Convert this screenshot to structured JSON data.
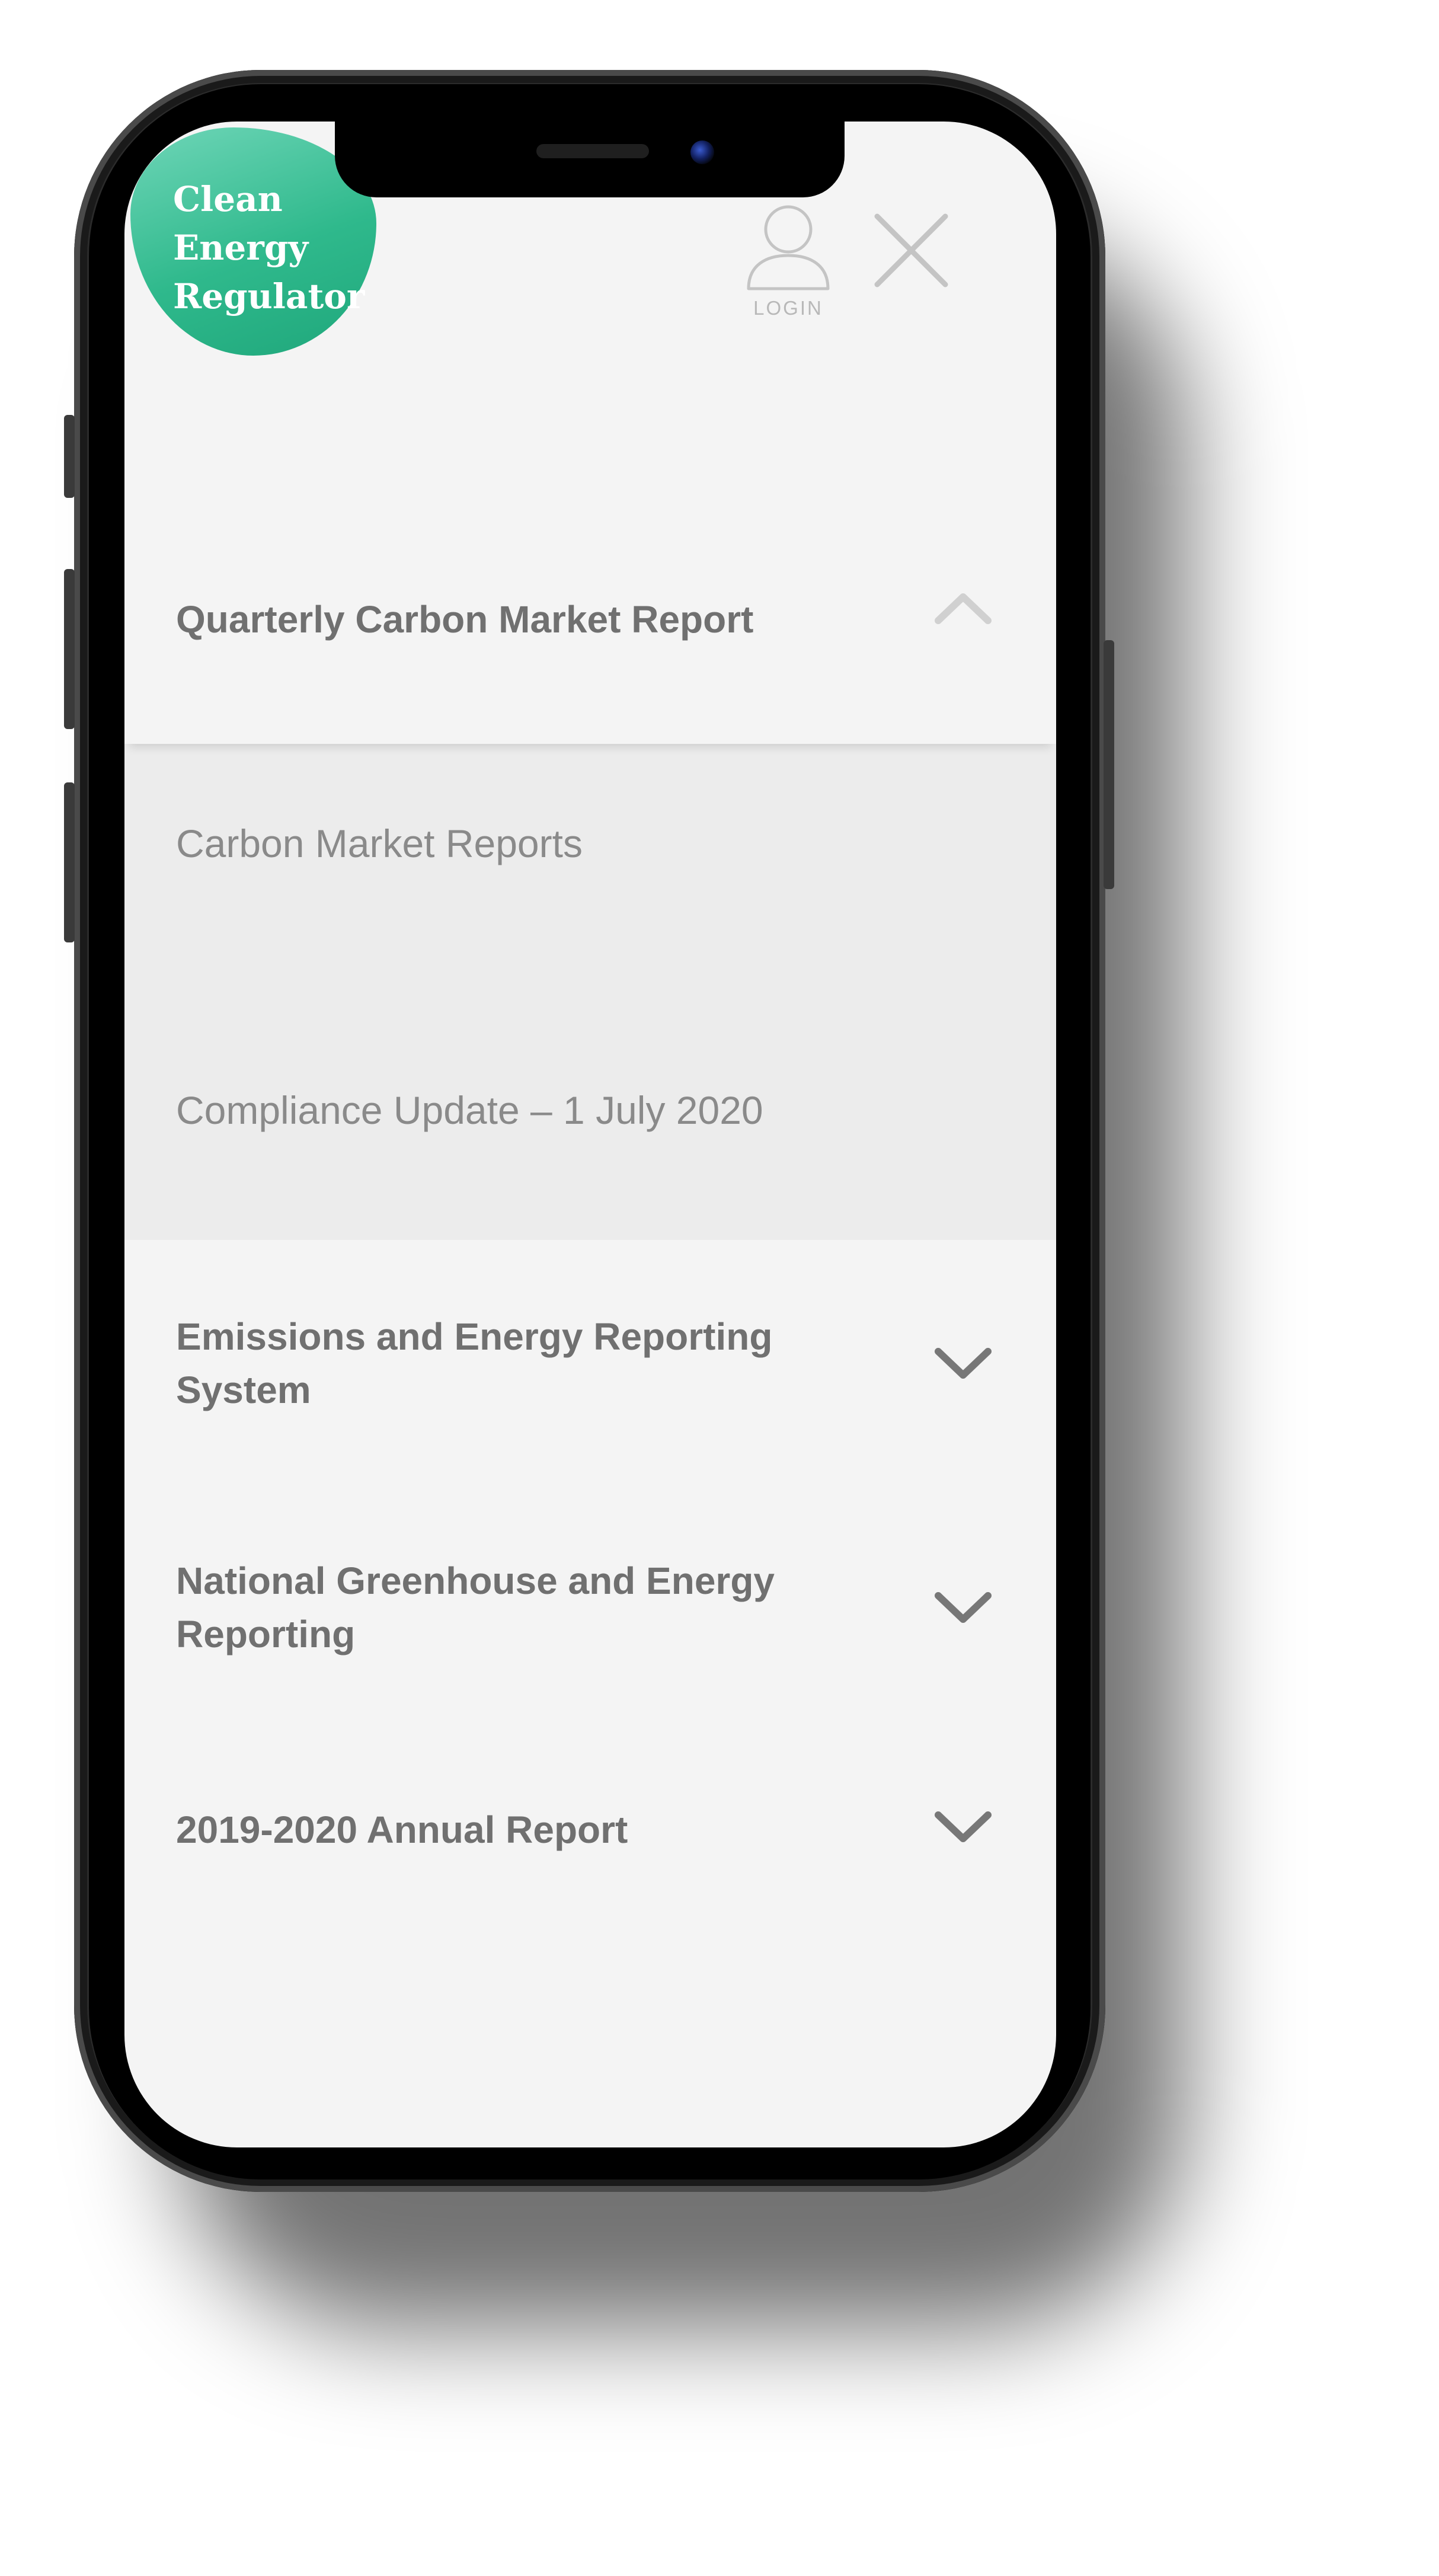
{
  "header": {
    "logo_text": "Clean\nEnergy\nRegulator",
    "login_label": "LOGIN"
  },
  "menu": {
    "expanded_item": {
      "label": "Quarterly Carbon Market Report",
      "icon": "chevron-up-icon",
      "subitems": [
        {
          "label": "Carbon Market Reports"
        },
        {
          "label": "Compliance Update – 1 July 2020"
        }
      ]
    },
    "items": [
      {
        "label": "Emissions and Energy Reporting System",
        "icon": "chevron-down-icon"
      },
      {
        "label": "National Greenhouse and Energy Reporting",
        "icon": "chevron-down-icon"
      },
      {
        "label": "2019-2020 Annual Report",
        "icon": "chevron-down-icon"
      }
    ]
  },
  "colors": {
    "brand_green": "#21ad7f",
    "logo_light": "#6fd6b8",
    "menu_background": "#f4f4f4",
    "submenu_background": "#ececec",
    "text_bold": "#707070",
    "text_light": "#8a8a8a"
  },
  "bottom_bar": {
    "icons": [
      "image-icon",
      "mail-icon",
      "link-icon"
    ]
  }
}
